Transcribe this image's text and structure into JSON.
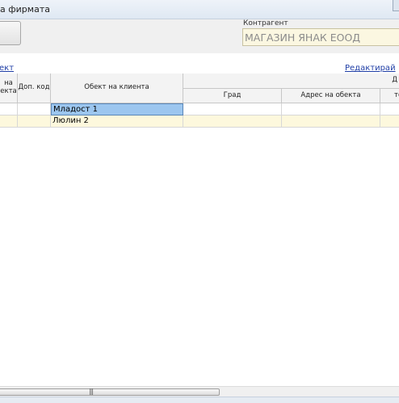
{
  "window": {
    "title": "а фирмата"
  },
  "contragent": {
    "label": "Контрагент",
    "value": "МАГАЗИН ЯНАК ЕООД"
  },
  "links": {
    "left": "ект",
    "edit": "Редактирай"
  },
  "table": {
    "headers": {
      "col_a": "на\nекта",
      "doc_code": "Доп. код",
      "client_object": "Обект на клиента",
      "group_top": "Д",
      "city": "Град",
      "address": "Адрес на обекта",
      "last": "те"
    },
    "rows": [
      {
        "object": "Младост 1"
      },
      {
        "object": "Люлин 2"
      }
    ]
  },
  "scroll": {
    "grip": "|||"
  }
}
